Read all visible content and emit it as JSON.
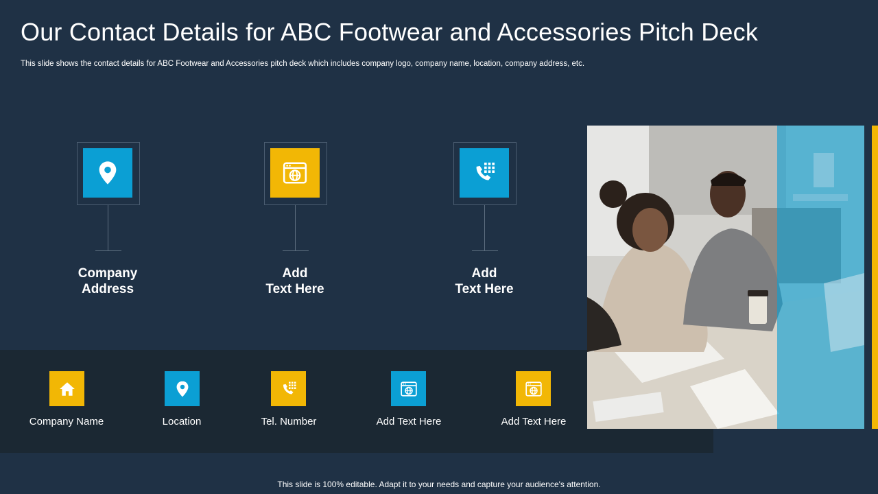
{
  "header": {
    "title": "Our Contact Details for ABC Footwear and Accessories Pitch Deck",
    "subtitle": "This slide shows the contact details for ABC Footwear and Accessories pitch deck which includes company logo, company name, location, company address, etc."
  },
  "top_cards": [
    {
      "label": "Company\nAddress",
      "icon": "location-pin-icon",
      "color": "#0b9fd4"
    },
    {
      "label": "Add\nText Here",
      "icon": "globe-browser-icon",
      "color": "#f2b705"
    },
    {
      "label": "Add\nText Here",
      "icon": "phone-keypad-icon",
      "color": "#0b9fd4"
    }
  ],
  "bottom_items": [
    {
      "label": "Company Name",
      "icon": "home-icon",
      "color": "#f2b705"
    },
    {
      "label": "Location",
      "icon": "location-pin-icon",
      "color": "#0b9fd4"
    },
    {
      "label": "Tel. Number",
      "icon": "phone-keypad-icon",
      "color": "#f2b705"
    },
    {
      "label": "Add Text Here",
      "icon": "globe-browser-icon",
      "color": "#0b9fd4"
    },
    {
      "label": "Add Text Here",
      "icon": "globe-browser-icon",
      "color": "#f2b705"
    }
  ],
  "footer": {
    "text": "This slide is 100% editable. Adapt it to your needs and capture your audience's attention."
  },
  "colors": {
    "background": "#1f3145",
    "band": "#1b2833",
    "blue": "#0b9fd4",
    "yellow": "#f2b705"
  }
}
